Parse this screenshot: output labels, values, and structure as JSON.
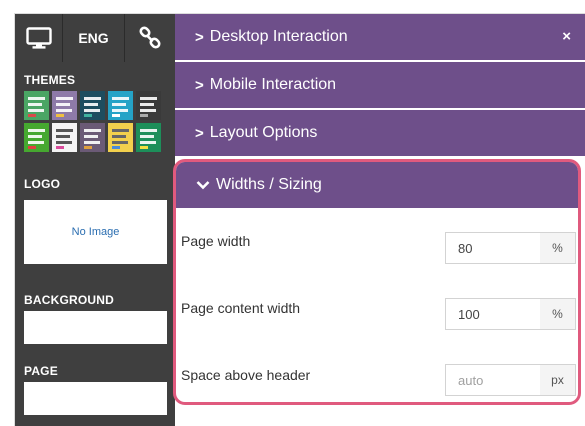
{
  "topbar": {
    "desktop_icon": "monitor-icon",
    "language_label": "ENG",
    "link_icon": "link-icon"
  },
  "sidebar": {
    "themes_label": "THEMES",
    "themes": [
      {
        "name": "theme-1",
        "color": "#4aa564"
      },
      {
        "name": "theme-2",
        "color": "#8e7aa8"
      },
      {
        "name": "theme-3",
        "color": "#1e4d5f"
      },
      {
        "name": "theme-4",
        "color": "#25a3c7"
      },
      {
        "name": "theme-5",
        "color": "#3a3a3a"
      },
      {
        "name": "theme-6",
        "color": "#46a830"
      },
      {
        "name": "theme-7",
        "color": "#f3f3f3"
      },
      {
        "name": "theme-8",
        "color": "#6b5a76"
      },
      {
        "name": "theme-9",
        "color": "#f2d04d"
      },
      {
        "name": "theme-10",
        "color": "#1d8f5a"
      }
    ],
    "logo_label": "LOGO",
    "logo_placeholder": "No Image",
    "background_label": "BACKGROUND",
    "page_label": "PAGE"
  },
  "panel": {
    "sections": [
      {
        "label": "Desktop Interaction",
        "expanded": false
      },
      {
        "label": "Mobile Interaction",
        "expanded": false
      },
      {
        "label": "Layout Options",
        "expanded": false
      }
    ],
    "close_symbol": "×",
    "open_section": {
      "label": "Widths / Sizing",
      "fields": [
        {
          "label": "Page width",
          "value": "80",
          "placeholder": "",
          "unit": "%"
        },
        {
          "label": "Page content width",
          "value": "100",
          "placeholder": "",
          "unit": "%"
        },
        {
          "label": "Space above header",
          "value": "",
          "placeholder": "auto",
          "unit": "px"
        }
      ]
    }
  },
  "colors": {
    "accent_purple": "#6e4f8a",
    "sidebar_bg": "#3f3f3f",
    "highlight_pink": "#e05a7e",
    "link_blue": "#2a6db0"
  }
}
